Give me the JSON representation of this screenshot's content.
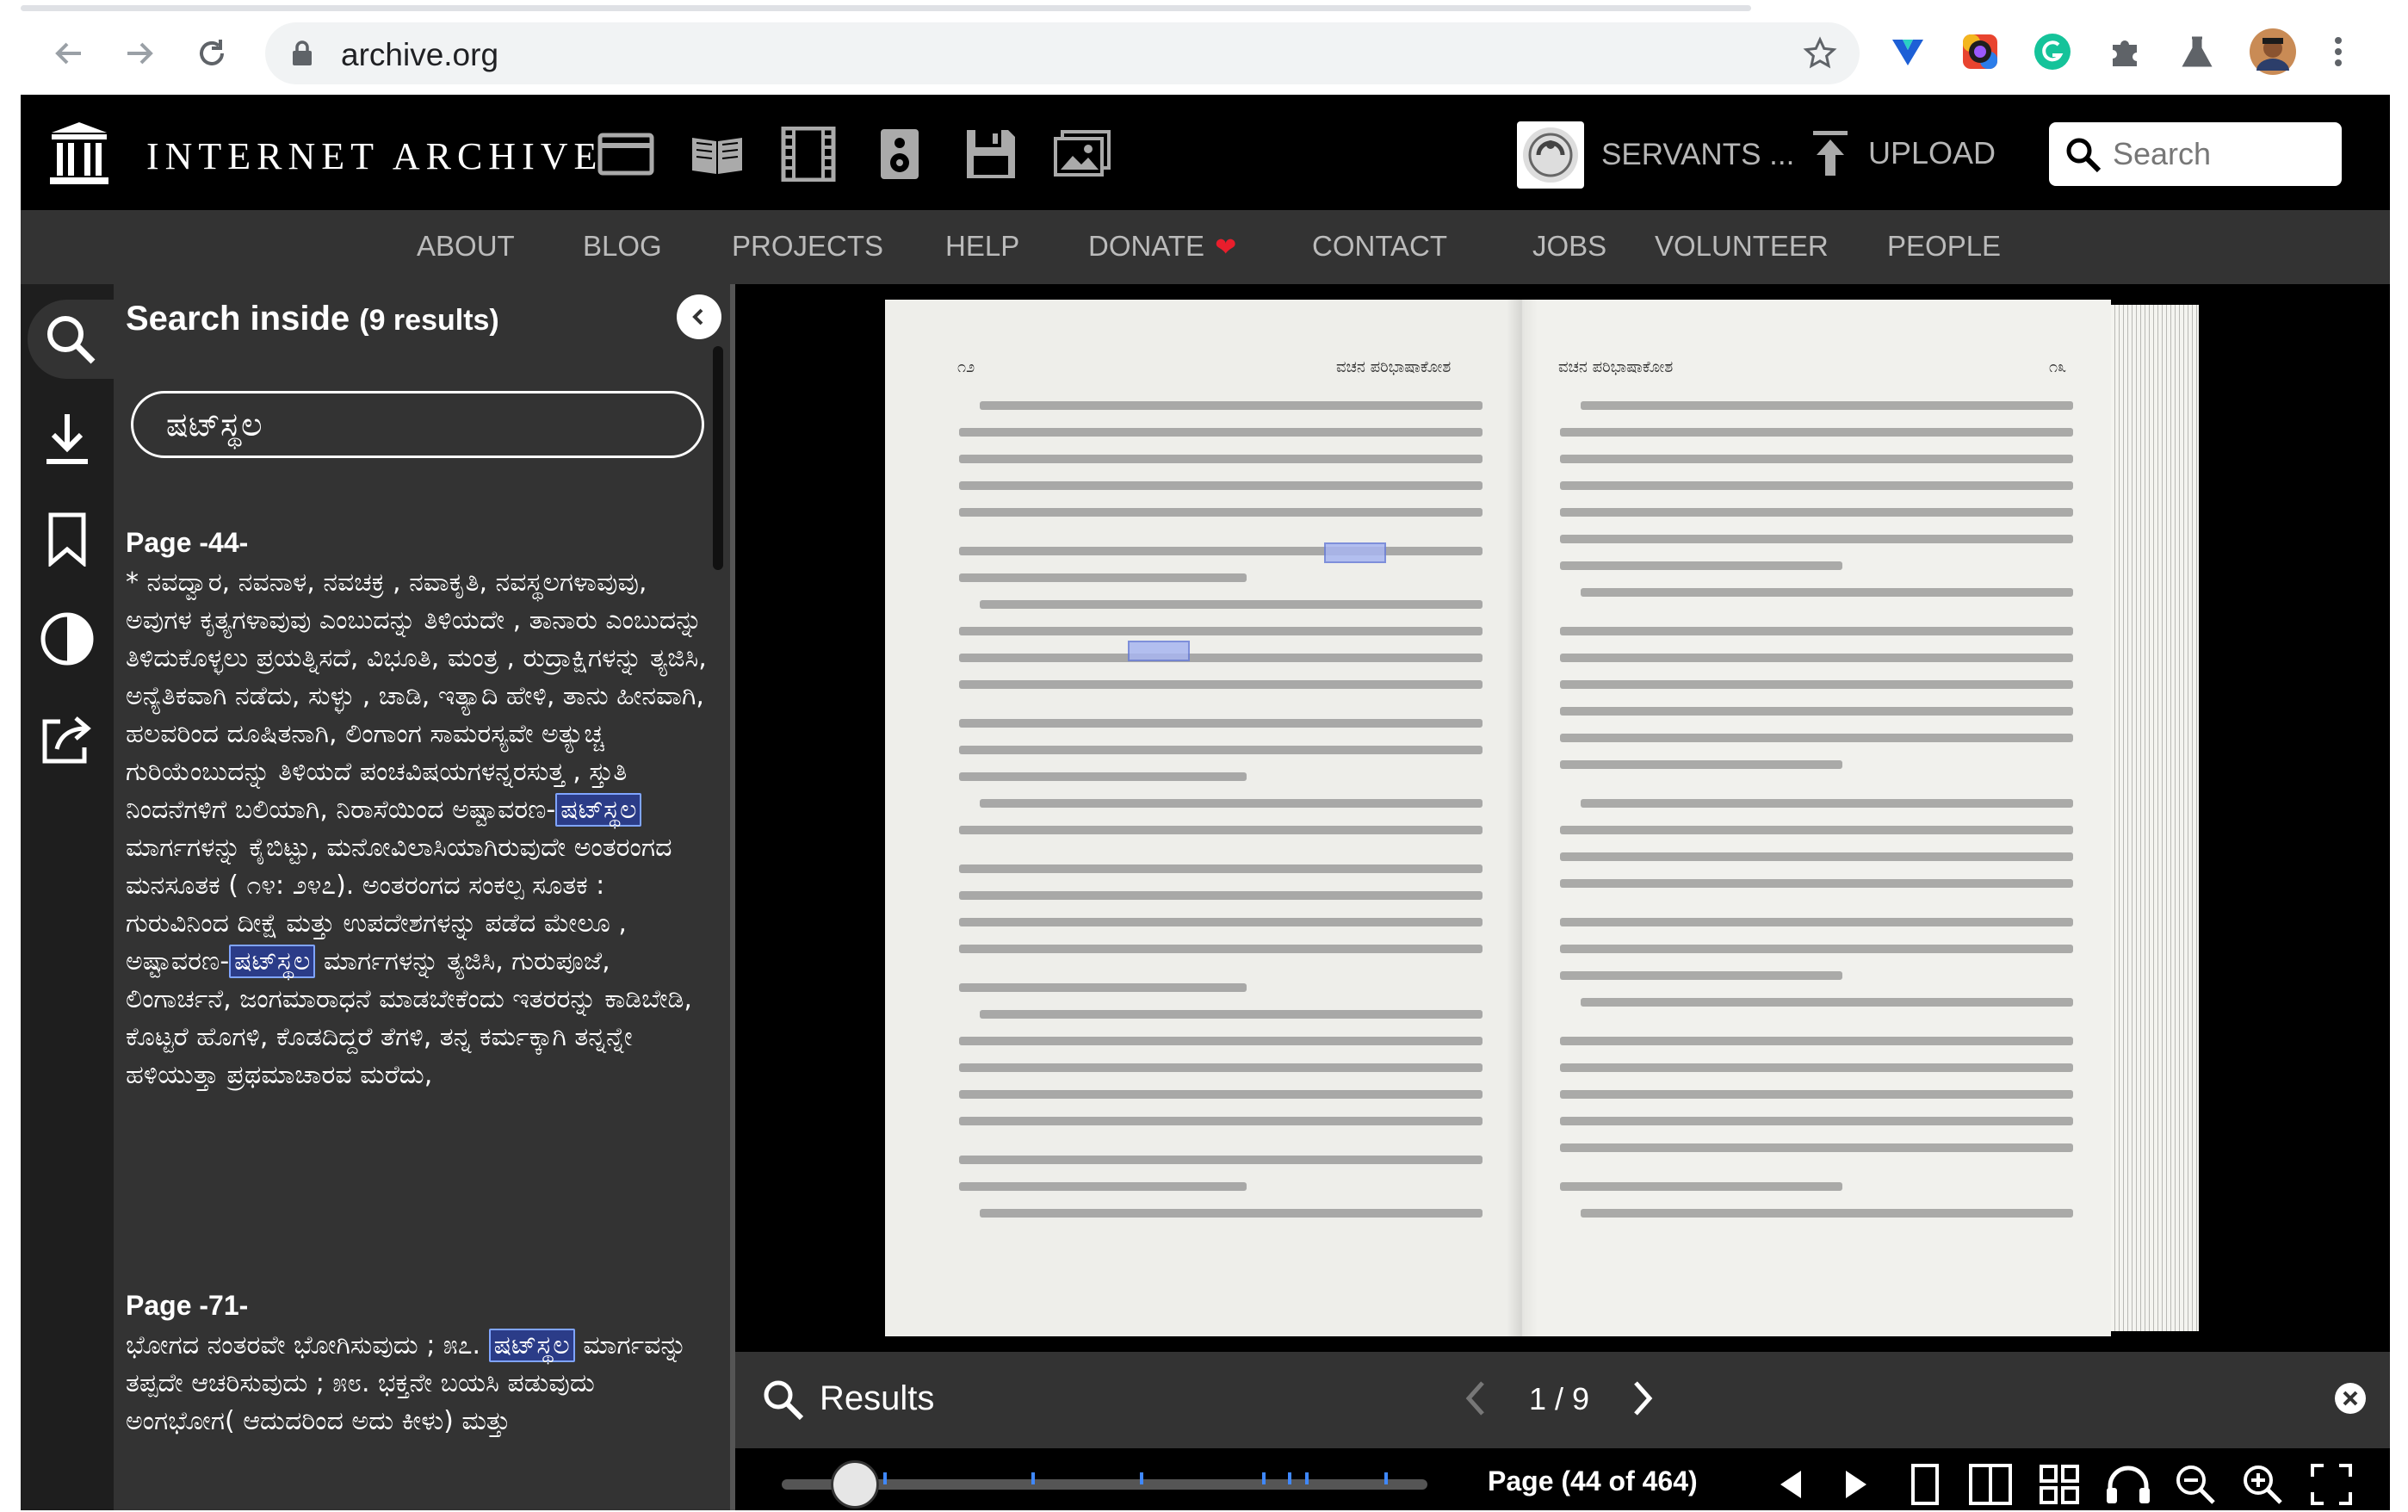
{
  "browser": {
    "url": "archive.org",
    "icons": [
      "back-arrow-icon",
      "forward-arrow-icon",
      "reload-icon",
      "lock-icon",
      "bookmark-star-icon",
      "extension-icons",
      "profile-avatar",
      "menu-kebab-icon"
    ]
  },
  "ia_header": {
    "brand": "INTERNET ARCHIVE",
    "media_icons": [
      "web-icon",
      "texts-book-icon",
      "video-film-icon",
      "audio-speaker-icon",
      "software-floppy-icon",
      "images-icon"
    ],
    "user_label": "SERVANTS ...",
    "upload_label": "UPLOAD",
    "search_placeholder": "Search"
  },
  "nav": {
    "links": [
      "ABOUT",
      "BLOG",
      "PROJECTS",
      "HELP",
      "DONATE",
      "CONTACT",
      "JOBS",
      "VOLUNTEER",
      "PEOPLE"
    ]
  },
  "side_rail": {
    "icons": [
      "search-icon",
      "download-icon",
      "bookmark-icon",
      "contrast-icon",
      "share-icon"
    ]
  },
  "search_panel": {
    "title": "Search inside",
    "count": "(9 results)",
    "query": "ಷಟ್‌ಸ್ಥಲ",
    "results": [
      {
        "page": "Page -44-",
        "before": "* ನವದ್ವಾರ, ನವನಾಳ, ನವಚಕ್ರ , ನವಾಕೃತಿ, ನವಸ್ಥಲಗಳಾವುವು, ಅವುಗಳ ಕೃತ್ಯಗಳಾವುವು ಎಂಬುದನ್ನು ತಿಳಿಯದೇ , ತಾನಾರು ಎಂಬುದನ್ನು ತಿಳಿದುಕೊಳ್ಳಲು ಪ್ರಯತ್ನಿಸದೆ, ವಿಭೂತಿ, ಮಂತ್ರ , ರುದ್ರಾಕ್ಷಿಗಳನ್ನು ತ್ಯಜಿಸಿ, ಅನ್ಯೆತಿಕವಾಗಿ ನಡೆದು, ಸುಳ್ಳು , ಚಾಡಿ, ಇತ್ಯಾದಿ ಹೇಳಿ, ತಾನು ಹೀನವಾಗಿ, ಹಲವರಿಂದ ದೂಷಿತನಾಗಿ, ಲಿಂಗಾಂಗ ಸಾಮರಸ್ಯವೇ ಅತ್ಯುಚ್ಚ ಗುರಿಯೆಂಬುದನ್ನು ತಿಳಿಯದೆ ಪಂಚವಿಷಯಗಳನ್ನರಸುತ್ತ , ಸ್ತುತಿ ನಿಂದನೆಗಳಿಗೆ ಬಲಿಯಾಗಿ, ನಿರಾಸೆಯಿಂದ ಅಷ್ಟಾವರಣ-",
        "match1": "ಷಟ್‌ಸ್ಥಲ",
        "middle": " ಮಾರ್ಗಗಳನ್ನು ಕೈಬಿಟ್ಟು, ಮನೋವಿಲಾಸಿಯಾಗಿರುವುದೇ ಅಂತರಂಗದ ಮನಸೂತಕ ( ೧೪: ೨೪೭). ಅಂತರಂಗದ ಸಂಕಲ್ಪ ಸೂತಕ : ಗುರುವಿನಿಂದ ದೀಕ್ಷೆ ಮತ್ತು ಉಪದೇಶಗಳನ್ನು ಪಡೆದ ಮೇಲೂ , ಅಷ್ಟಾವರಣ-",
        "match2": "ಷಟ್‌ಸ್ಥಲ",
        "after": " ಮಾರ್ಗಗಳನ್ನು ತ್ಯಜಿಸಿ, ಗುರುಪೂಜೆ, ಲಿಂಗಾರ್ಚನೆ, ಜಂಗಮಾರಾಧನೆ ಮಾಡಬೇಕೆಂದು ಇತರರನ್ನು ಕಾಡಿಬೇಡಿ, ಕೊಟ್ಟರೆ ಹೊಗಳಿ, ಕೊಡದಿದ್ದರೆ ತೆಗಳಿ, ತನ್ನ ಕರ್ಮಕ್ಕಾಗಿ ತನ್ನನ್ನೇ ಹಳಿಯುತ್ತಾ ಪ್ರಥಮಾಚಾರವ ಮರೆದು,"
      },
      {
        "page": "Page -71-",
        "before": "ಭೋಗದ ನಂತರವೇ ಭೋಗಿಸುವುದು ; ೫೭. ",
        "match1": "ಷಟ್‌ಸ್ಥಲ",
        "middle": " ಮಾರ್ಗವನ್ನು ತಪ್ಪದೇ ಆಚರಿಸುವುದು ; ೫೮. ಭಕ್ತನೇ ಬಯಸಿ ಪಡುವುದು ಅಂಗಭೋಗ( ಆದುದರಿಂದ ಅದು ಕೀಳು) ಮತ್ತು"
      }
    ]
  },
  "book": {
    "left_running_head": "ವಚನ ಪರಿಭಾಷಾಕೋಶ",
    "right_running_head": "ವಚನ ಪರಿಭಾಷಾಕೋಶ",
    "left_page_number": "೧೨",
    "right_page_number": "೧೩"
  },
  "results_bar": {
    "label": "Results",
    "counter": "1 / 9"
  },
  "controls": {
    "page_indicator": "Page (44 of 464)",
    "progress_fraction": 0.094,
    "icons": [
      "page-back-icon",
      "page-forward-icon",
      "one-page-view-icon",
      "two-page-view-icon",
      "thumbnail-view-icon",
      "read-aloud-icon",
      "zoom-out-icon",
      "zoom-in-icon",
      "fullscreen-icon"
    ]
  },
  "colors": {
    "ia_black": "#000000",
    "nav_gray": "#333333",
    "highlight": "#2b3c88",
    "tick_blue": "#3f88ff",
    "donate_heart": "#e91e2c"
  }
}
